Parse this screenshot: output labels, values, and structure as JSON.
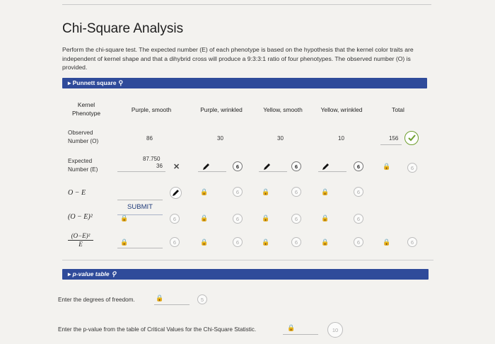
{
  "page": {
    "title": "Chi-Square Analysis",
    "intro": "Perform the chi-square test. The expected number (E) of each phenotype is based on the hypothesis that the kernel color traits are independent of kernel shape and that a dihybrid cross will produce a 9:3:3:1 ratio of four phenotypes. The observed number (O) is provided."
  },
  "punnett": {
    "label": "Punnett square"
  },
  "table": {
    "row_header": "Kernel Phenotype",
    "columns": [
      "Purple, smooth",
      "Purple, wrinkled",
      "Yellow, smooth",
      "Yellow, wrinkled",
      "Total"
    ],
    "observed_label": "Observed Number (O)",
    "observed": [
      "86",
      "30",
      "30",
      "10",
      "156"
    ],
    "expected_label": "Expected Number (E)",
    "expected_value": "87.750",
    "expected_sub": "36",
    "badge_6": "6",
    "o_minus_e_label": "O − E",
    "sq_label": "(O − E)²",
    "ratio_num": "(O−E)²",
    "ratio_den": "E",
    "submit": "SUBMIT"
  },
  "pvalue": {
    "label": "p-value table",
    "dof_prompt": "Enter the degrees of freedom.",
    "dof_badge": "5",
    "p_prompt": "Enter the p-value from the table of Critical Values for the Chi-Square Statistic.",
    "p_badge": "10"
  },
  "colors": {
    "bar": "#2f4b9a",
    "check": "#6f9f2f",
    "lock": "#c9c16a"
  }
}
